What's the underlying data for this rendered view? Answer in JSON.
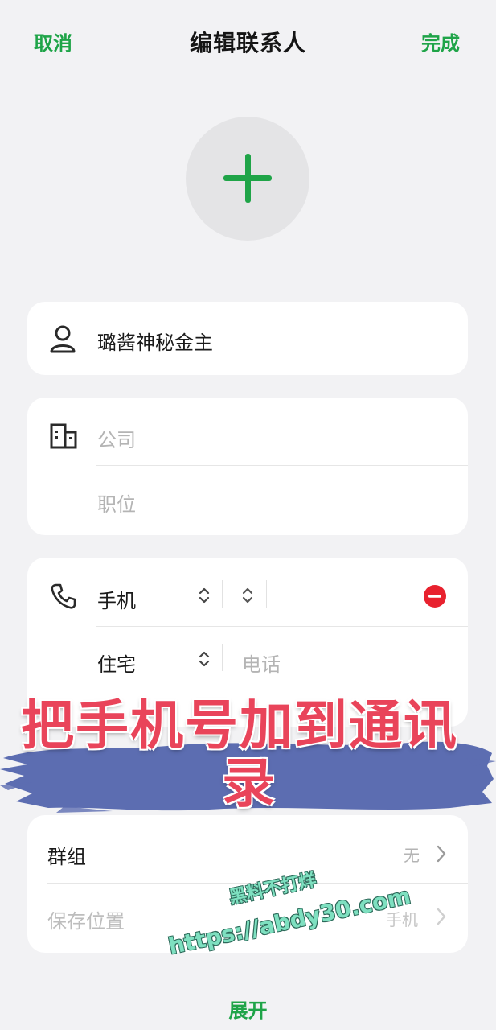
{
  "nav": {
    "cancel": "取消",
    "title": "编辑联系人",
    "done": "完成"
  },
  "avatar": {
    "icon": "plus-icon"
  },
  "name": {
    "icon": "person-icon",
    "value": "璐酱神秘金主"
  },
  "org": {
    "icon": "building-icon",
    "company_placeholder": "公司",
    "position_placeholder": "职位"
  },
  "phone": {
    "icon": "phone-icon",
    "rows": [
      {
        "label": "手机",
        "value": "",
        "placeholder": ""
      },
      {
        "label": "住宅",
        "value": "",
        "placeholder": "电话"
      }
    ]
  },
  "overlay": {
    "line1": "把手机号加到通讯",
    "line2": "录"
  },
  "settings": {
    "group_label": "群组",
    "group_value": "无",
    "storage_label": "保存位置",
    "storage_value": "手机"
  },
  "watermark": {
    "line1": "黑料不打烊",
    "line2": "https://abdy30.com"
  },
  "expand": "展开",
  "colors": {
    "accent": "#1fa448",
    "remove": "#e8212e",
    "overlay_text": "#e9445a",
    "brush": "#5c6db1"
  }
}
